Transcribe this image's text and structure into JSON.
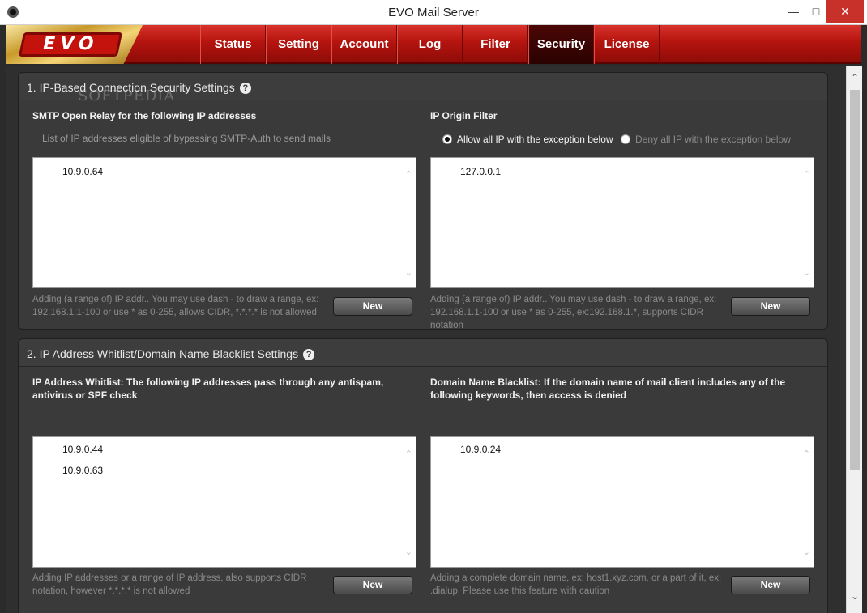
{
  "window": {
    "title": "EVO Mail Server"
  },
  "logo": {
    "text": "EVO"
  },
  "nav": {
    "tabs": [
      "Status",
      "Setting",
      "Account",
      "Log",
      "Filter",
      "Security",
      "License"
    ],
    "active": "Security"
  },
  "section1": {
    "title": "1. IP-Based Connection Security Settings",
    "relay": {
      "label": "SMTP Open Relay for the following IP addresses",
      "sublabel": "List of IP addresses eligible of bypassing SMTP-Auth to send mails",
      "items": [
        "10.9.0.64"
      ],
      "hint": "Adding (a range of) IP addr.. You may use dash - to draw a range, ex: 192.168.1.1-100 or use * as 0-255, allows CIDR, *.*.*.* is not allowed",
      "button": "New"
    },
    "origin": {
      "label": "IP Origin Filter",
      "radio_allow": "Allow all IP with the exception below",
      "radio_deny": "Deny all IP with the exception below",
      "selected": "allow",
      "items": [
        "127.0.0.1"
      ],
      "hint": "Adding (a range of) IP addr.. You may use dash - to draw a range, ex: 192.168.1.1-100 or use * as 0-255, ex:192.168.1.*, supports CIDR notation",
      "button": "New"
    }
  },
  "section2": {
    "title": "2. IP Address Whitlist/Domain Name Blacklist Settings",
    "whitelist": {
      "label": "IP Address Whitlist: The following IP addresses pass through any antispam, antivirus or SPF check",
      "items": [
        "10.9.0.44",
        "10.9.0.63"
      ],
      "hint": "Adding IP addresses or a range of IP address, also supports CIDR notation, however *.*.*.* is not allowed",
      "button": "New"
    },
    "blacklist": {
      "label": "Domain Name Blacklist: If the domain name of mail client includes any of the following keywords, then access is denied",
      "items": [
        "10.9.0.24"
      ],
      "hint": "Adding a complete domain name, ex: host1.xyz.com, or a part of it, ex: .dialup. Please use this feature with caution",
      "button": "New"
    }
  },
  "watermark": "SOFTPEDIA",
  "colors": {
    "nav_red": "#b5140f",
    "active_tab": "#2a0201",
    "panel": "#3a3a3a",
    "gold": "#c89a2b"
  }
}
